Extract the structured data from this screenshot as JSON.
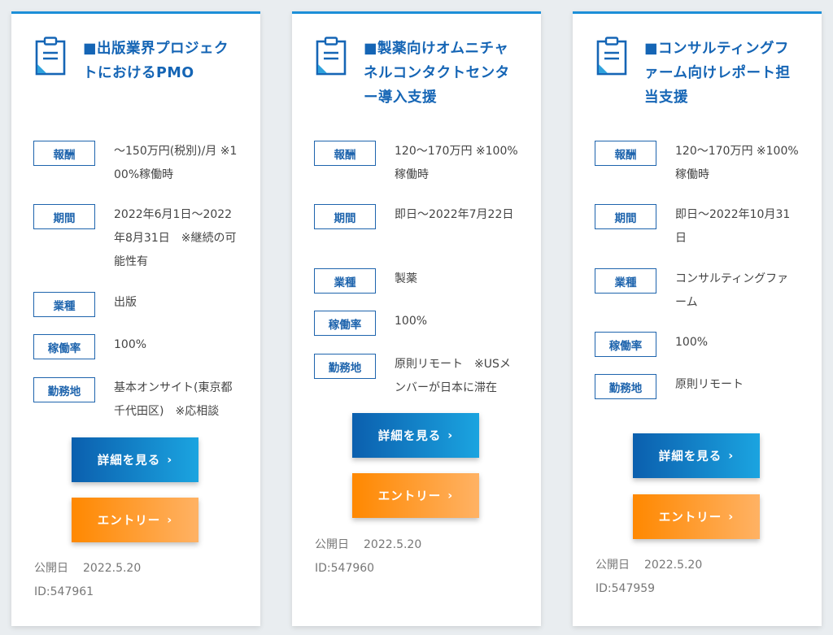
{
  "labels": {
    "reward": "報酬",
    "period": "期間",
    "industry": "業種",
    "utilization": "稼働率",
    "location": "勤務地",
    "detail_button": "詳細を見る",
    "entry_button": "エントリー",
    "chevron": "›",
    "published": "公開日"
  },
  "colors": {
    "accent_blue": "#1565b5",
    "label_border": "#1e64ad",
    "detail_gradient": [
      "#0b5fae",
      "#1ba4e0"
    ],
    "entry_gradient": [
      "#ff8800",
      "#ffb264"
    ],
    "card_top_border": "#1c8fd8"
  },
  "icons": {
    "card_icon": "document-clipboard-icon"
  },
  "cards": [
    {
      "title": "■出版業界プロジェクトにおけるPMO",
      "reward": "～150万円(税別)/月 ※100%稼働時",
      "period": "2022年6月1日～2022年8月31日　※継続の可能性有",
      "industry": "出版",
      "utilization": "100%",
      "location": "基本オンサイト(東京都千代田区)　※応相談",
      "published_date": "2022.5.20",
      "id": "ID:547961"
    },
    {
      "title": "■製薬向けオムニチャネルコンタクトセンター導入支援",
      "reward": "120～170万円 ※100%稼働時",
      "period": "即日～2022年7月22日",
      "industry": "製薬",
      "utilization": "100%",
      "location": "原則リモート　※USメンバーが日本に滞在",
      "published_date": "2022.5.20",
      "id": "ID:547960"
    },
    {
      "title": "■コンサルティングファーム向けレポート担当支援",
      "reward": "120～170万円 ※100%稼働時",
      "period": "即日～2022年10月31日",
      "industry": "コンサルティングファーム",
      "utilization": "100%",
      "location": "原則リモート",
      "published_date": "2022.5.20",
      "id": "ID:547959"
    }
  ]
}
